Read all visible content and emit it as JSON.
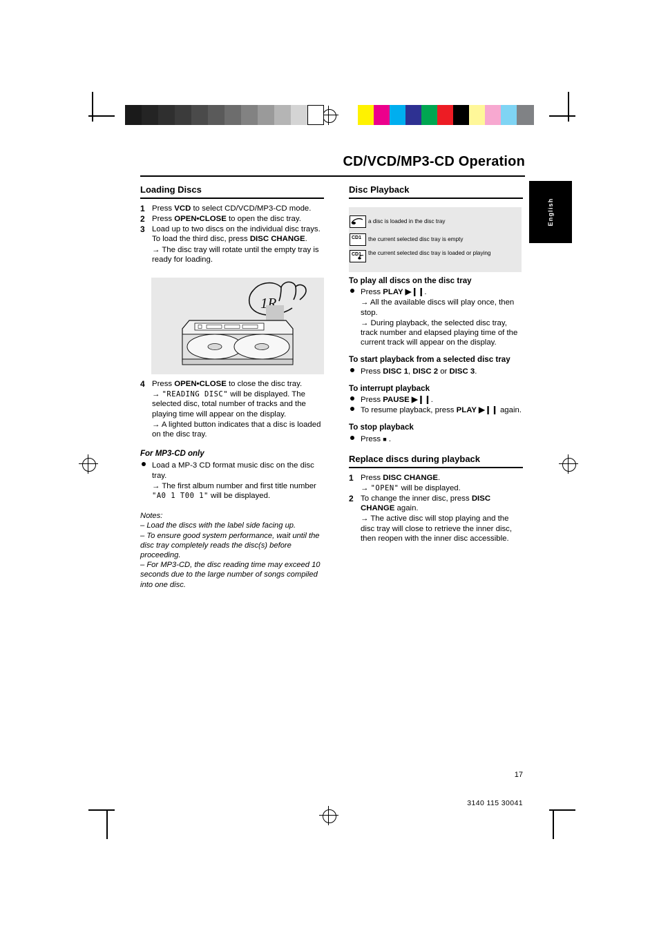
{
  "header": {
    "title": "CD/VCD/MP3-CD Operation",
    "side_tab": "English"
  },
  "footer": {
    "page_number": "17",
    "doc_number": "3140 115 30041"
  },
  "left_column": {
    "section_title": "Loading Discs",
    "steps": [
      {
        "num": "1",
        "html": "Press <b>VCD</b> to select CD/VCD/MP3-CD mode."
      },
      {
        "num": "2",
        "html": "Press <b>OPEN&bull;CLOSE</b> to open the disc tray."
      },
      {
        "num": "3",
        "html": "Load up to two discs on the individual disc trays. To load the third disc, press <b>DISC CHANGE</b>."
      },
      {
        "num": "",
        "html": "&rarr; The disc tray will rotate until the empty tray is ready for loading."
      }
    ],
    "step4": [
      {
        "num": "4",
        "html": "Press <b>OPEN&bull;CLOSE</b> to close the disc tray."
      },
      {
        "num": "",
        "html": "&rarr; <span class=\"lcd\">\"READING DISC\"</span> will be displayed. The selected disc, total number of tracks and the playing time will appear on the display."
      },
      {
        "num": "",
        "html": "&rarr; A lighted button indicates that a disc is loaded on the disc tray."
      }
    ],
    "mp3_heading": "For MP3-CD only",
    "mp3_items": [
      {
        "bullet": true,
        "html": "Load a MP-3 CD format music disc on the disc tray."
      },
      {
        "bullet": false,
        "html": "&rarr; The first album number and first title number <span class=\"lcd\">\"A0 1 T00 1\"</span> will be displayed."
      }
    ],
    "notes_label": "Notes:",
    "notes": [
      "–  Load the discs with the label side facing up.",
      "–  To ensure good system performance, wait until the disc tray completely reads the disc(s) before proceeding.",
      "–  For MP3-CD, the disc reading time may exceed 10 seconds due to the large number of songs compiled into one disc."
    ]
  },
  "right_column": {
    "section_title": "Disc Playback",
    "legend": [
      {
        "icon": "disc-icon",
        "icon_label": "",
        "text": "a disc is loaded in the disc tray"
      },
      {
        "icon": "cd1-icon",
        "icon_label": "CD1",
        "text": "the current selected disc tray is empty"
      },
      {
        "icon": "cd1-loaded-icon",
        "icon_label": "CD1",
        "text": "the current selected disc tray is loaded or playing"
      }
    ],
    "play_all_heading": "To play all discs on the disc tray",
    "play_all_items": [
      {
        "bullet": true,
        "html": "Press <b>PLAY &#9654;&#10073;&#10073;</b>."
      },
      {
        "bullet": false,
        "html": "&rarr; All the available discs will play once, then stop."
      },
      {
        "bullet": false,
        "html": "&rarr; During playback, the selected disc tray, track number and elapsed playing time of the current track will appear on the display."
      }
    ],
    "selected_heading": "To start playback from a selected disc tray",
    "selected_items": [
      {
        "bullet": true,
        "html": "Press <b>DISC 1</b>, <b>DISC 2</b> or <b>DISC 3</b>."
      }
    ],
    "interrupt_heading": "To interrupt playback",
    "interrupt_items": [
      {
        "bullet": true,
        "html": "Press <b>PAUSE &#9654;&#10073;&#10073;</b>."
      },
      {
        "bullet": true,
        "html": "To resume playback, press <b>PLAY &#9654;&#10073;&#10073;</b> again."
      }
    ],
    "stop_heading": "To stop playback",
    "stop_items": [
      {
        "bullet": true,
        "html": "Press <span style=\"font-size:9px\">&#9632;</span> ."
      }
    ],
    "replace_title": "Replace discs during playback",
    "replace_items": [
      {
        "num": "1",
        "html": "Press <b>DISC CHANGE</b>."
      },
      {
        "num": "",
        "html": "&rarr; <span class=\"lcd\">\"OPEN\"</span> will be displayed."
      },
      {
        "num": "2",
        "html": "To change the inner disc, press <b>DISC CHANGE</b> again."
      },
      {
        "num": "",
        "html": "&rarr; The active disc will stop playing and the disc tray will close to retrieve the inner disc, then reopen with the inner disc accessible."
      }
    ]
  },
  "color_bars": {
    "grayscale": [
      "#1a1a1a",
      "#242424",
      "#2f2f2f",
      "#3b3b3b",
      "#4a4a4a",
      "#5a5a5a",
      "#6d6d6d",
      "#828282",
      "#9a9a9a",
      "#b5b5b5",
      "#d4d4d4",
      "#ffffff"
    ],
    "colors": [
      "#fff200",
      "#ec008c",
      "#00aeef",
      "#2e3192",
      "#00a651",
      "#ed1c24",
      "#000000",
      "#fff799",
      "#f7a8d0",
      "#7fd4f4",
      "#808285"
    ]
  }
}
